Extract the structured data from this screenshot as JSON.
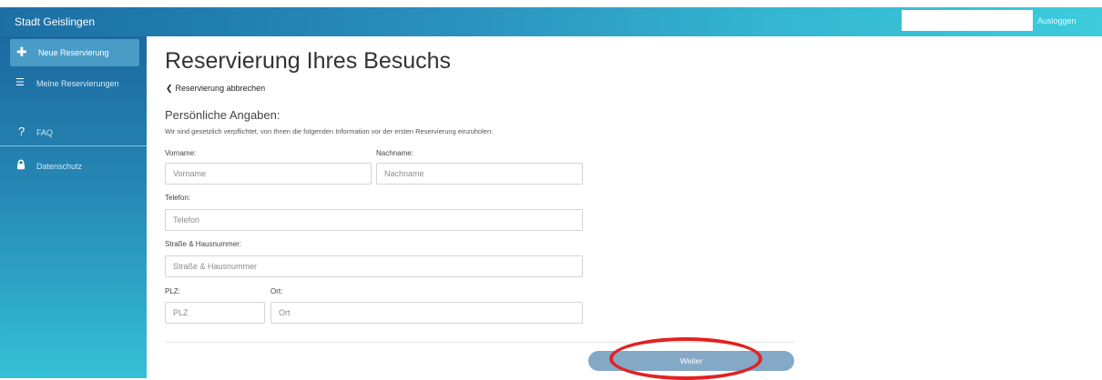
{
  "header": {
    "brand": "Stadt Geislingen",
    "logout_label": "Ausloggen"
  },
  "sidebar": {
    "items": [
      {
        "label": "Neue Reservierung",
        "icon": "plus-icon",
        "active": true
      },
      {
        "label": "Meine Reservierungen",
        "icon": "list-icon",
        "active": false
      },
      {
        "label": "FAQ",
        "icon": "question-icon",
        "active": false
      },
      {
        "label": "Datenschutz",
        "icon": "lock-icon",
        "active": false
      }
    ]
  },
  "main": {
    "title": "Reservierung Ihres Besuchs",
    "back_label": "Reservierung abbrechen",
    "section_title": "Persönliche Angaben:",
    "section_desc": "Wir sind gesetzlich verpflichtet, von Ihnen die folgenden Information vor der ersten Reservierung einzuholen:"
  },
  "form": {
    "vorname": {
      "label": "Vorname:",
      "placeholder": "Vorname",
      "value": ""
    },
    "nachname": {
      "label": "Nachname:",
      "placeholder": "Nachname",
      "value": ""
    },
    "telefon": {
      "label": "Telefon:",
      "placeholder": "Telefon",
      "value": ""
    },
    "strasse": {
      "label": "Straße & Hausnummer:",
      "placeholder": "Straße & Hausnummer",
      "value": ""
    },
    "plz": {
      "label": "PLZ:",
      "placeholder": "PLZ",
      "value": ""
    },
    "ort": {
      "label": "Ort:",
      "placeholder": "Ort",
      "value": ""
    },
    "submit_label": "Weiter"
  },
  "colors": {
    "accent": "#1d6fa3",
    "button": "#84a9c7",
    "highlight": "#e32121"
  }
}
